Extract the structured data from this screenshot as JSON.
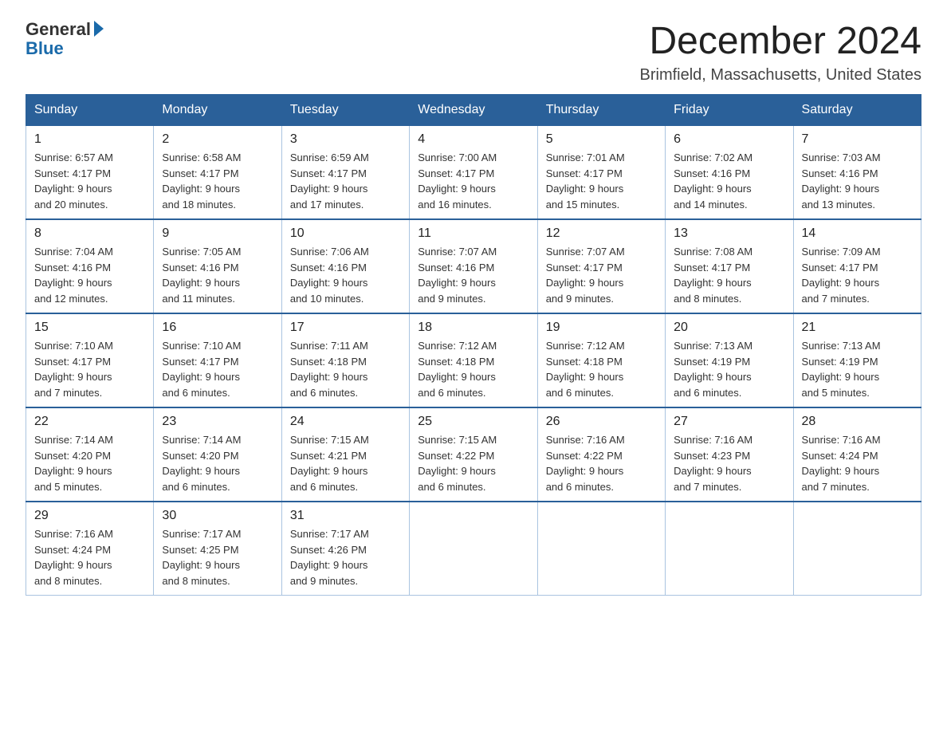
{
  "logo": {
    "general": "General",
    "blue": "Blue"
  },
  "title": "December 2024",
  "subtitle": "Brimfield, Massachusetts, United States",
  "days_header": [
    "Sunday",
    "Monday",
    "Tuesday",
    "Wednesday",
    "Thursday",
    "Friday",
    "Saturday"
  ],
  "weeks": [
    [
      {
        "day": "1",
        "sunrise": "6:57 AM",
        "sunset": "4:17 PM",
        "daylight": "9 hours and 20 minutes."
      },
      {
        "day": "2",
        "sunrise": "6:58 AM",
        "sunset": "4:17 PM",
        "daylight": "9 hours and 18 minutes."
      },
      {
        "day": "3",
        "sunrise": "6:59 AM",
        "sunset": "4:17 PM",
        "daylight": "9 hours and 17 minutes."
      },
      {
        "day": "4",
        "sunrise": "7:00 AM",
        "sunset": "4:17 PM",
        "daylight": "9 hours and 16 minutes."
      },
      {
        "day": "5",
        "sunrise": "7:01 AM",
        "sunset": "4:17 PM",
        "daylight": "9 hours and 15 minutes."
      },
      {
        "day": "6",
        "sunrise": "7:02 AM",
        "sunset": "4:16 PM",
        "daylight": "9 hours and 14 minutes."
      },
      {
        "day": "7",
        "sunrise": "7:03 AM",
        "sunset": "4:16 PM",
        "daylight": "9 hours and 13 minutes."
      }
    ],
    [
      {
        "day": "8",
        "sunrise": "7:04 AM",
        "sunset": "4:16 PM",
        "daylight": "9 hours and 12 minutes."
      },
      {
        "day": "9",
        "sunrise": "7:05 AM",
        "sunset": "4:16 PM",
        "daylight": "9 hours and 11 minutes."
      },
      {
        "day": "10",
        "sunrise": "7:06 AM",
        "sunset": "4:16 PM",
        "daylight": "9 hours and 10 minutes."
      },
      {
        "day": "11",
        "sunrise": "7:07 AM",
        "sunset": "4:16 PM",
        "daylight": "9 hours and 9 minutes."
      },
      {
        "day": "12",
        "sunrise": "7:07 AM",
        "sunset": "4:17 PM",
        "daylight": "9 hours and 9 minutes."
      },
      {
        "day": "13",
        "sunrise": "7:08 AM",
        "sunset": "4:17 PM",
        "daylight": "9 hours and 8 minutes."
      },
      {
        "day": "14",
        "sunrise": "7:09 AM",
        "sunset": "4:17 PM",
        "daylight": "9 hours and 7 minutes."
      }
    ],
    [
      {
        "day": "15",
        "sunrise": "7:10 AM",
        "sunset": "4:17 PM",
        "daylight": "9 hours and 7 minutes."
      },
      {
        "day": "16",
        "sunrise": "7:10 AM",
        "sunset": "4:17 PM",
        "daylight": "9 hours and 6 minutes."
      },
      {
        "day": "17",
        "sunrise": "7:11 AM",
        "sunset": "4:18 PM",
        "daylight": "9 hours and 6 minutes."
      },
      {
        "day": "18",
        "sunrise": "7:12 AM",
        "sunset": "4:18 PM",
        "daylight": "9 hours and 6 minutes."
      },
      {
        "day": "19",
        "sunrise": "7:12 AM",
        "sunset": "4:18 PM",
        "daylight": "9 hours and 6 minutes."
      },
      {
        "day": "20",
        "sunrise": "7:13 AM",
        "sunset": "4:19 PM",
        "daylight": "9 hours and 6 minutes."
      },
      {
        "day": "21",
        "sunrise": "7:13 AM",
        "sunset": "4:19 PM",
        "daylight": "9 hours and 5 minutes."
      }
    ],
    [
      {
        "day": "22",
        "sunrise": "7:14 AM",
        "sunset": "4:20 PM",
        "daylight": "9 hours and 5 minutes."
      },
      {
        "day": "23",
        "sunrise": "7:14 AM",
        "sunset": "4:20 PM",
        "daylight": "9 hours and 6 minutes."
      },
      {
        "day": "24",
        "sunrise": "7:15 AM",
        "sunset": "4:21 PM",
        "daylight": "9 hours and 6 minutes."
      },
      {
        "day": "25",
        "sunrise": "7:15 AM",
        "sunset": "4:22 PM",
        "daylight": "9 hours and 6 minutes."
      },
      {
        "day": "26",
        "sunrise": "7:16 AM",
        "sunset": "4:22 PM",
        "daylight": "9 hours and 6 minutes."
      },
      {
        "day": "27",
        "sunrise": "7:16 AM",
        "sunset": "4:23 PM",
        "daylight": "9 hours and 7 minutes."
      },
      {
        "day": "28",
        "sunrise": "7:16 AM",
        "sunset": "4:24 PM",
        "daylight": "9 hours and 7 minutes."
      }
    ],
    [
      {
        "day": "29",
        "sunrise": "7:16 AM",
        "sunset": "4:24 PM",
        "daylight": "9 hours and 8 minutes."
      },
      {
        "day": "30",
        "sunrise": "7:17 AM",
        "sunset": "4:25 PM",
        "daylight": "9 hours and 8 minutes."
      },
      {
        "day": "31",
        "sunrise": "7:17 AM",
        "sunset": "4:26 PM",
        "daylight": "9 hours and 9 minutes."
      },
      null,
      null,
      null,
      null
    ]
  ],
  "labels": {
    "sunrise": "Sunrise: ",
    "sunset": "Sunset: ",
    "daylight": "Daylight: 9 hours"
  }
}
